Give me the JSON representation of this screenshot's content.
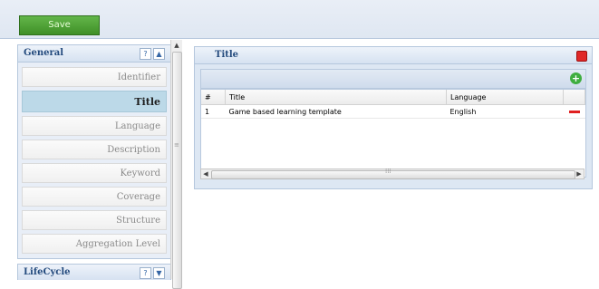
{
  "toolbar": {
    "save_label": "Save"
  },
  "general_panel": {
    "title": "General",
    "help_label": "?",
    "collapse_label": "▲",
    "items": [
      {
        "label": "Identifier",
        "active": false
      },
      {
        "label": "Title",
        "active": true
      },
      {
        "label": "Language",
        "active": false
      },
      {
        "label": "Description",
        "active": false
      },
      {
        "label": "Keyword",
        "active": false
      },
      {
        "label": "Coverage",
        "active": false
      },
      {
        "label": "Structure",
        "active": false
      },
      {
        "label": "Aggregation Level",
        "active": false
      }
    ]
  },
  "lifecycle_panel": {
    "title": "LifeCycle",
    "help_label": "?",
    "expand_label": "▼"
  },
  "title_panel": {
    "title": "Title",
    "columns": [
      "#",
      "Title",
      "Language"
    ],
    "rows": [
      {
        "num": "1",
        "title": "Game based learning template",
        "language": "English"
      }
    ]
  },
  "icons": {
    "add": "add-circle-icon",
    "remove": "remove-icon",
    "close": "close-icon"
  },
  "colors": {
    "save_button": "#4a9f33",
    "active_item": "#bcd9e8",
    "close": "#e02828",
    "add": "#3fae3f"
  }
}
